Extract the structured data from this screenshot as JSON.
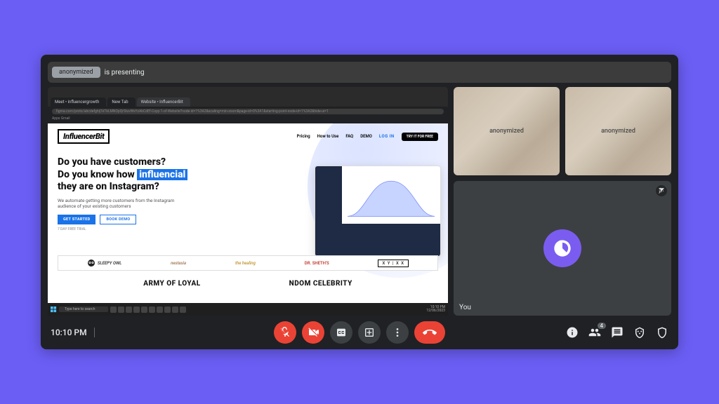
{
  "presenting": {
    "presenter": "anonymized",
    "suffix": "is presenting"
  },
  "browser": {
    "tabs": [
      "Meet • influencergrowth",
      "New Tab",
      "Website • InfluencerBit"
    ],
    "url": "figma.com/proto/abcdefghij1kTkLMNOpQrStuvWxYzAbCdEf-Copy-1-of-Website?node-id=1%3A2&scaling=min-zoom&page-id=0%3A1&starting-point-node-id=1%3A2&hide-ui=1",
    "bookmarks": "Apps   Gmail"
  },
  "page": {
    "logo": "InfluencerBit",
    "nav": {
      "pricing": "Pricing",
      "how": "How to Use",
      "faq": "FAQ",
      "demo": "DEMO",
      "login": "LOG IN",
      "try": "TRY IT FOR FREE"
    },
    "hero": {
      "l1": "Do you have customers?",
      "l2a": "Do you know how ",
      "l2b": "influencial",
      "l3": "they are on Instagram?",
      "sub": "We automate getting more customers from the Instagram audience of your existing customers",
      "cta1": "GET STARTED",
      "cta2": "BOOK DEMO",
      "trial": "7 DAY FREE TRIAL"
    },
    "brands": {
      "b1": "SLEEPY OWL",
      "b2": "nestasia",
      "b3": "the healing",
      "b4": "DR. SHETH'S",
      "b5": "X Y | X X"
    },
    "tagline_a": "ARMY OF LOYAL",
    "tagline_b": "NDOM CELEBRITY"
  },
  "taskbar": {
    "search": "Type here to search",
    "time": "10:10 PM",
    "date": "12/06/2023"
  },
  "tiles": {
    "p1": "anonymized",
    "p2": "anonymized",
    "self": "You"
  },
  "bottom": {
    "time": "10:10 PM",
    "people_count": "4"
  }
}
